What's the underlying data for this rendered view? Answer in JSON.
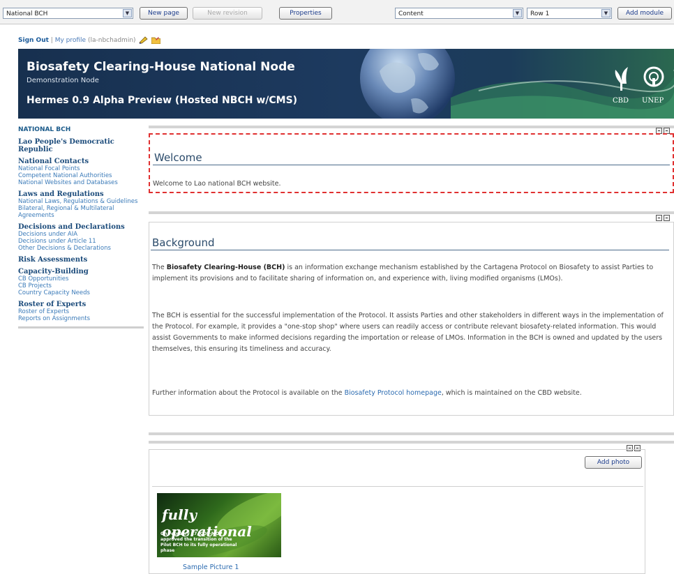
{
  "toolbar": {
    "site_select": "National BCH",
    "new_page": "New page",
    "new_revision": "New revision",
    "properties": "Properties",
    "content_select": "Content",
    "row_select": "Row 1",
    "add_module": "Add module"
  },
  "user_nav": {
    "sign_out": "Sign Out",
    "separator": "|",
    "my_profile": "My profile",
    "username": "(la-nbchadmin)"
  },
  "banner": {
    "title": "Biosafety Clearing-House National Node",
    "subtitle": "Demonstration Node",
    "version": "Hermes 0.9 Alpha Preview (Hosted NBCH w/CMS)",
    "logo_cbd": "CBD",
    "logo_unep": "UNEP"
  },
  "sidebar": {
    "heading": "NATIONAL BCH",
    "sections": [
      {
        "title": "Lao People's Democratic Republic",
        "links": []
      },
      {
        "title": "National Contacts",
        "links": [
          "National Focal Points",
          "Competent National Authorities",
          "National Websites and Databases"
        ]
      },
      {
        "title": "Laws and Regulations",
        "links": [
          "National Laws, Regulations & Guidelines",
          "Bilateral, Regional & Multilateral Agreements"
        ]
      },
      {
        "title": "Decisions and Declarations",
        "links": [
          "Decisions under AIA",
          "Decisions under Article 11",
          "Other Decisions & Declarations"
        ]
      },
      {
        "title": "Risk Assessments",
        "links": []
      },
      {
        "title": "Capacity-Building",
        "links": [
          "CB Opportunities",
          "CB Projects",
          "Country Capacity Needs"
        ]
      },
      {
        "title": "Roster of Experts",
        "links": [
          "Roster of Experts",
          "Reports on Assignments"
        ]
      }
    ]
  },
  "welcome": {
    "heading": "Welcome",
    "text": "Welcome to Lao national BCH website."
  },
  "background": {
    "heading": "Background",
    "p1_prefix": "The ",
    "p1_bold": "Biosafety Clearing-House (BCH)",
    "p1_rest": " is an information exchange mechanism established by the Cartagena Protocol on Biosafety to assist Parties to implement its provisions and to facilitate sharing of information on, and experience with, living modified organisms (LMOs).",
    "p2": "The BCH is essential for the successful implementation of the Protocol. It assists Parties and other stakeholders in different ways in the implementation of the Protocol. For example, it provides a \"one-stop shop\" where users can readily access or contribute relevant biosafety-related information. This would assist Governments to make informed decisions regarding the importation or release of LMOs. Information in the BCH is owned and updated by the users themselves, this ensuring its timeliness and accuracy.",
    "p3_prefix": "Further information about the Protocol is available on the ",
    "p3_link": "Biosafety Protocol homepage",
    "p3_rest": ", which is maintained on the CBD website."
  },
  "gallery": {
    "add_photo": "Add photo",
    "photo_big": "fully operational",
    "photo_small": "On February 27, COP-MOP approved the transition of the Pilot BCH to its fully operational phase",
    "caption": "Sample Picture 1"
  }
}
